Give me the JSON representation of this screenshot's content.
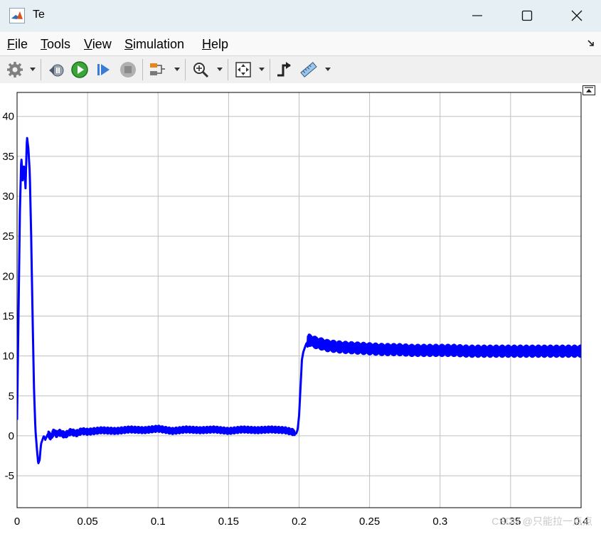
{
  "window": {
    "title": "Te",
    "buttons": {
      "minimize": "minimize",
      "maximize": "maximize",
      "close": "close"
    }
  },
  "menubar": {
    "items": [
      {
        "label": "File",
        "mnemonic": "F",
        "rest": "ile"
      },
      {
        "label": "Tools",
        "mnemonic": "T",
        "rest": "ools"
      },
      {
        "label": "View",
        "mnemonic": "V",
        "rest": "iew"
      },
      {
        "label": "Simulation",
        "mnemonic": "S",
        "rest": "imulation"
      },
      {
        "label": "Help",
        "mnemonic": "H",
        "rest": "elp"
      }
    ]
  },
  "toolbar": {
    "icons": [
      "settings-icon",
      "step-back-icon",
      "run-icon",
      "step-forward-icon",
      "stop-icon",
      "highlight-signal-icon",
      "zoom-icon",
      "autoscale-icon",
      "triggers-icon",
      "cursor-measurements-icon"
    ]
  },
  "colors": {
    "signal": "#0000ff",
    "grid": "#bfbfbf",
    "axes": "#000000",
    "accent_orange": "#e8861c"
  },
  "watermark": "CSDN @只能拉一点点",
  "chart_data": {
    "type": "line",
    "title": "",
    "xlabel": "",
    "ylabel": "",
    "xlim": [
      0,
      0.4
    ],
    "ylim": [
      -9,
      43
    ],
    "xticks": [
      0,
      0.05,
      0.1,
      0.15,
      0.2,
      0.25,
      0.3,
      0.35,
      0.4
    ],
    "xtick_labels": [
      "0",
      "0.05",
      "0.1",
      "0.15",
      "0.2",
      "0.25",
      "0.3",
      "0.35",
      "0.4"
    ],
    "yticks": [
      -5,
      0,
      5,
      10,
      15,
      20,
      25,
      30,
      35,
      40
    ],
    "ytick_labels": [
      "-5",
      "0",
      "5",
      "10",
      "15",
      "20",
      "25",
      "30",
      "35",
      "40"
    ],
    "grid": true,
    "series": [
      {
        "color": "#0000ff",
        "x": [
          0,
          0.001,
          0.002,
          0.003,
          0.004,
          0.005,
          0.006,
          0.007,
          0.008,
          0.009,
          0.01,
          0.011,
          0.012,
          0.013,
          0.014,
          0.015,
          0.016,
          0.017,
          0.018,
          0.019,
          0.02,
          0.022,
          0.024,
          0.026,
          0.028,
          0.03,
          0.034,
          0.038,
          0.042,
          0.046,
          0.05,
          0.06,
          0.07,
          0.08,
          0.09,
          0.1,
          0.11,
          0.12,
          0.13,
          0.14,
          0.15,
          0.16,
          0.17,
          0.18,
          0.19,
          0.195,
          0.198,
          0.199,
          0.2,
          0.201,
          0.202,
          0.203,
          0.204,
          0.205,
          0.207,
          0.21,
          0.213,
          0.216,
          0.22,
          0.23,
          0.24,
          0.25,
          0.26,
          0.27,
          0.28,
          0.29,
          0.3,
          0.31,
          0.32,
          0.33,
          0.34,
          0.35,
          0.36,
          0.37,
          0.38,
          0.39,
          0.4
        ],
        "y": [
          2,
          15,
          28,
          35,
          32,
          34,
          31,
          37.5,
          36,
          33,
          25,
          15,
          6,
          0.8,
          -1.5,
          -3.5,
          -3,
          -1,
          -0.5,
          0,
          -0.5,
          0.3,
          -0.2,
          0.5,
          0.2,
          0.4,
          0.1,
          0.5,
          0.3,
          0.6,
          0.5,
          0.7,
          0.6,
          0.8,
          0.7,
          0.9,
          0.6,
          0.8,
          0.7,
          0.8,
          0.6,
          0.8,
          0.7,
          0.8,
          0.7,
          0.5,
          0.3,
          0.8,
          2.5,
          6,
          9.5,
          10.5,
          11,
          11.5,
          12,
          11.8,
          11.6,
          11.5,
          11.3,
          11.1,
          11,
          10.9,
          10.8,
          10.8,
          10.7,
          10.7,
          10.7,
          10.7,
          10.6,
          10.6,
          10.6,
          10.6,
          10.6,
          10.6,
          10.6,
          10.6,
          10.6
        ],
        "ripple_amplitude": 0.7
      }
    ]
  }
}
